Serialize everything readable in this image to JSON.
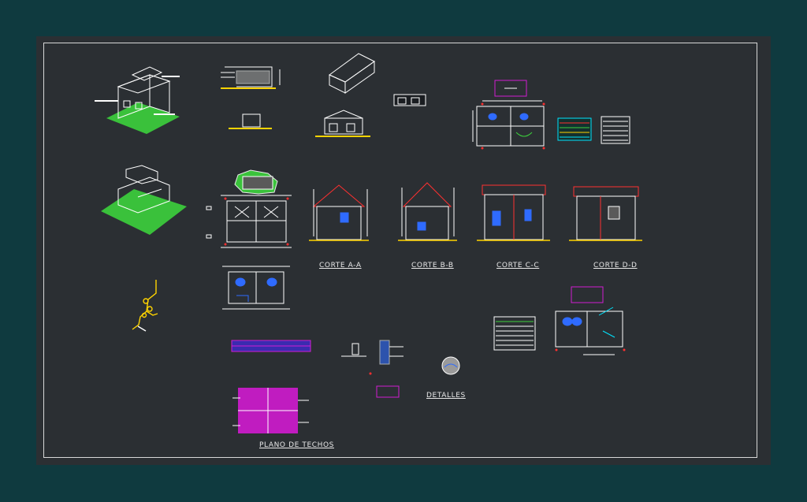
{
  "colors": {
    "background": "#0f3a3f",
    "canvas": "#2b2f33",
    "frame": "#d8d8d8",
    "line": "#ffffff",
    "red": "#ff3030",
    "green": "#3cd23c",
    "blue": "#2f6bff",
    "magenta": "#d21ed2",
    "cyan": "#00e5ff",
    "yellow": "#ffd400",
    "orange": "#ff9a1a",
    "gray": "#9a9a9a"
  },
  "labels": {
    "corte_aa": "CORTE  A-A",
    "corte_bb": "CORTE B-B",
    "corte_cc": "CORTE C-C",
    "corte_dd": "CORTE D-D",
    "detalles": "DETALLES",
    "plano_techos": "PLANO DE TECHOS"
  }
}
